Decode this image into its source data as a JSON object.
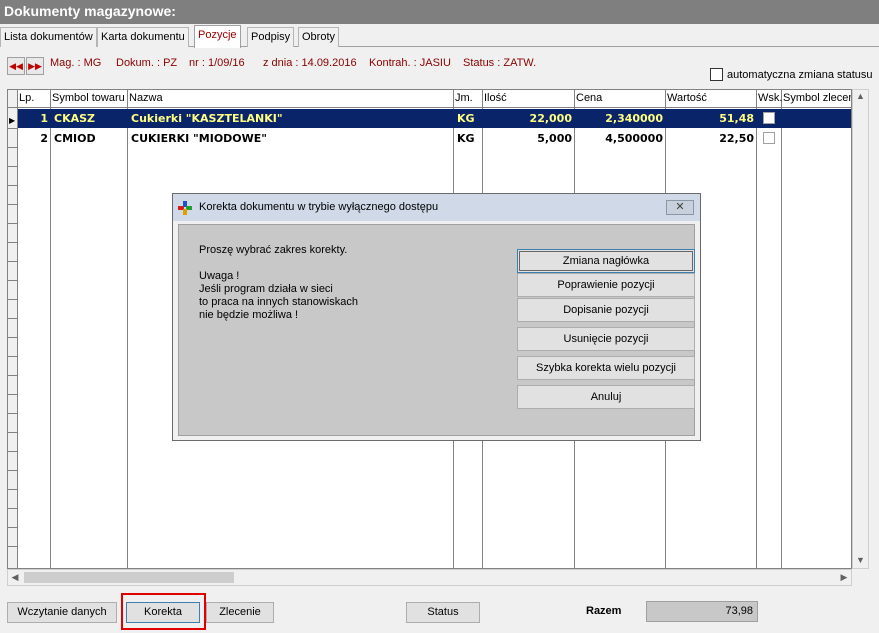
{
  "window": {
    "title": "Dokumenty magazynowe:"
  },
  "tabs": [
    {
      "label": "Lista dokumentów",
      "active": false
    },
    {
      "label": "Karta dokumentu",
      "active": false
    },
    {
      "label": "Pozycje",
      "active": true
    },
    {
      "label": "Podpisy",
      "active": false
    },
    {
      "label": "Obroty",
      "active": false
    }
  ],
  "header": {
    "mag": "Mag. : MG",
    "dokum": "Dokum. : PZ",
    "nr": "nr : 1/09/16",
    "date": "z dnia : 14.09.2016",
    "kontrah": "Kontrah. : JASIU",
    "status": "Status : ZATW."
  },
  "auto_status_label": "automatyczna zmiana statusu",
  "grid": {
    "columns": [
      "Lp.",
      "Symbol towaru",
      "Nazwa",
      "Jm.",
      "Ilość",
      "Cena",
      "Wartość",
      "Wsk.",
      "Symbol zlecen"
    ],
    "rows": [
      {
        "lp": "1",
        "symbol": "CKASZ",
        "nazwa": "Cukierki \"KASZTELANKI\"",
        "jm": "KG",
        "ilosc": "22,000",
        "cena": "2,340000",
        "wartosc": "51,48"
      },
      {
        "lp": "2",
        "symbol": "CMIOD",
        "nazwa": "CUKIERKI \"MIODOWE\"",
        "jm": "KG",
        "ilosc": "5,000",
        "cena": "4,500000",
        "wartosc": "22,50"
      }
    ]
  },
  "dialog": {
    "title": "Korekta dokumentu w trybie wyłącznego dostępu",
    "prompt": "Proszę wybrać zakres korekty.",
    "warning_title": "Uwaga !",
    "warning_line1": "Jeśli program działa w sieci",
    "warning_line2": "to praca na innych stanowiskach",
    "warning_line3": "nie będzie możliwa !",
    "buttons": [
      "Zmiana nagłówka",
      "Poprawienie pozycji",
      "Dopisanie pozycji",
      "Usunięcie pozycji",
      "Szybka korekta wielu pozycji",
      "Anuluj"
    ]
  },
  "footer": {
    "wczytanie_label": "Wczytanie danych",
    "korekta_label": "Korekta",
    "zlecenie_label": "Zlecenie",
    "status_label": "Status",
    "razem_label": "Razem",
    "razem_value": "73,98"
  }
}
